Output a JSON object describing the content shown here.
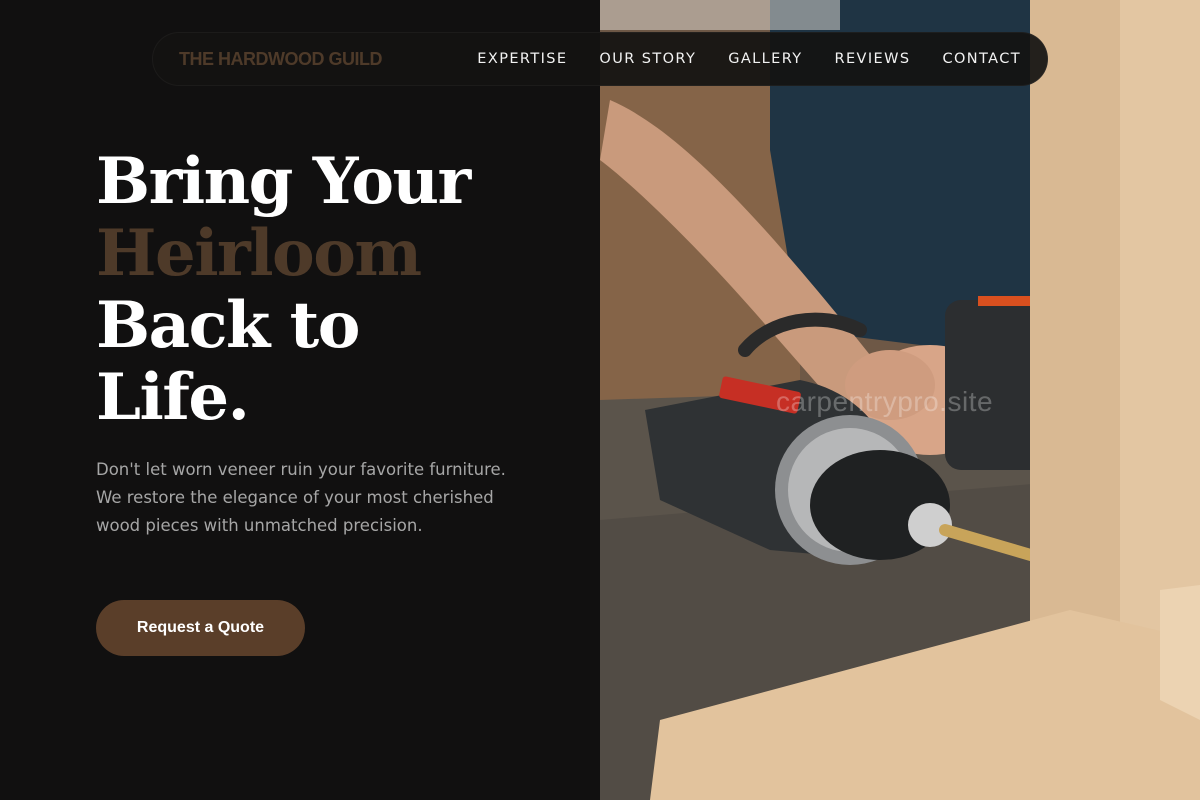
{
  "brand": {
    "name": "THE HARDWOOD GUILD"
  },
  "nav": {
    "items": [
      {
        "label": "EXPERTISE"
      },
      {
        "label": "OUR STORY"
      },
      {
        "label": "GALLERY"
      },
      {
        "label": "REVIEWS"
      },
      {
        "label": "CONTACT"
      }
    ]
  },
  "hero": {
    "title_line1": "Bring Your",
    "title_accent": "Heirloom",
    "title_line3": "Back to",
    "title_line4": "Life.",
    "description": "Don't let worn veneer ruin your favorite furniture. We restore the elegance of your most cherished wood pieces with unmatched precision.",
    "cta_label": "Request a Quote"
  },
  "photo": {
    "watermark": "carpentrypro.site"
  },
  "colors": {
    "background": "#111010",
    "accent_brown": "#4e3a29",
    "button_brown": "#5a3e29",
    "text_muted": "#a6a6a6"
  }
}
